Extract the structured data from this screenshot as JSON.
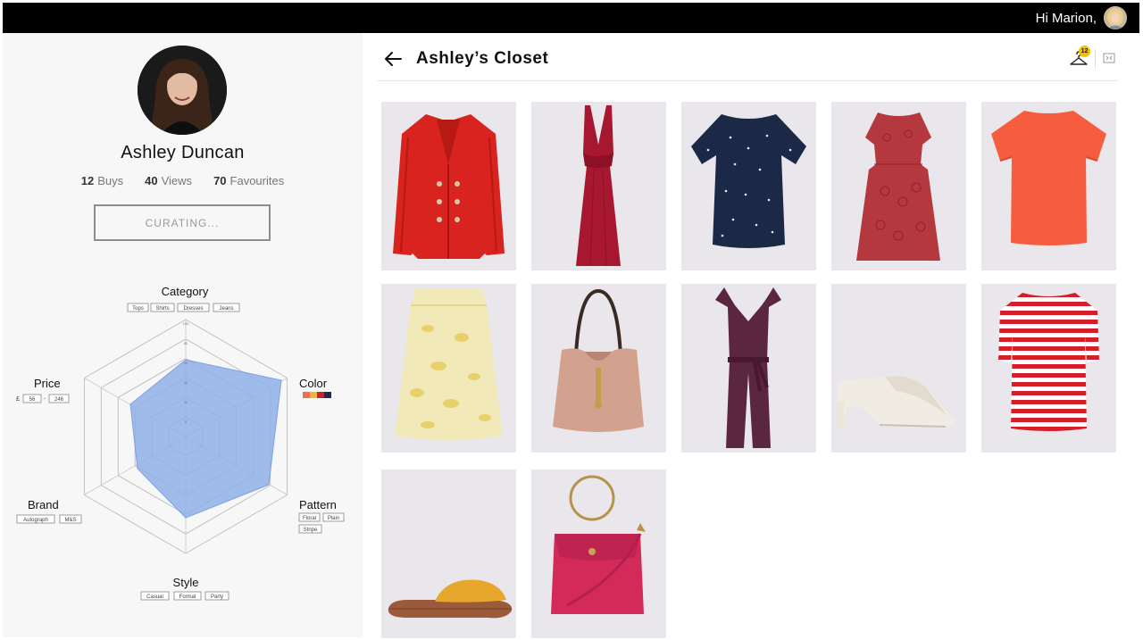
{
  "topbar": {
    "greeting": "Hi Marion,"
  },
  "profile": {
    "name": "Ashley Duncan",
    "stats": [
      {
        "value": "12",
        "label": "Buys"
      },
      {
        "value": "40",
        "label": "Views"
      },
      {
        "value": "70",
        "label": "Favourites"
      }
    ],
    "curate_label": "CURATING..."
  },
  "radar": {
    "axes": {
      "category": "Category",
      "color": "Color",
      "pattern": "Pattern",
      "style": "Style",
      "brand": "Brand",
      "price": "Price"
    },
    "category_tags": [
      "Tops",
      "Shirts",
      "Dresses",
      "Jeans"
    ],
    "pattern_tags": [
      "Floral",
      "Plain",
      "Stripe"
    ],
    "style_tags": [
      "Casual",
      "Formal",
      "Party"
    ],
    "brand_tags": [
      "Autograph",
      "M&S"
    ],
    "price": {
      "currency": "£",
      "min": "56",
      "max": "246"
    },
    "color_swatches": [
      "#e8734a",
      "#f0b43a",
      "#c0262f",
      "#1f2a4f"
    ],
    "ticks": [
      "0",
      "20",
      "40",
      "60",
      "80",
      "100"
    ],
    "fill_color": "#8fb0e8"
  },
  "closet": {
    "title": "Ashley’s Closet",
    "badge_count": "12",
    "items": [
      {
        "name": "Red double-breasted blazer",
        "icon": "blazer"
      },
      {
        "name": "Burgundy maxi dress",
        "icon": "maxi-dress"
      },
      {
        "name": "Navy printed top",
        "icon": "tshirt"
      },
      {
        "name": "Red lace dress",
        "icon": "lace-dress"
      },
      {
        "name": "Coral top",
        "icon": "tshirt"
      },
      {
        "name": "Yellow floral skirt",
        "icon": "skirt"
      },
      {
        "name": "Tan tote bag",
        "icon": "tote"
      },
      {
        "name": "Plum jumpsuit",
        "icon": "jumpsuit"
      },
      {
        "name": "White heeled mule",
        "icon": "mule"
      },
      {
        "name": "Red striped top",
        "icon": "striped-top"
      },
      {
        "name": "Mustard slide sandal",
        "icon": "sandal"
      },
      {
        "name": "Pink ring-handle bag",
        "icon": "ring-bag"
      }
    ]
  }
}
